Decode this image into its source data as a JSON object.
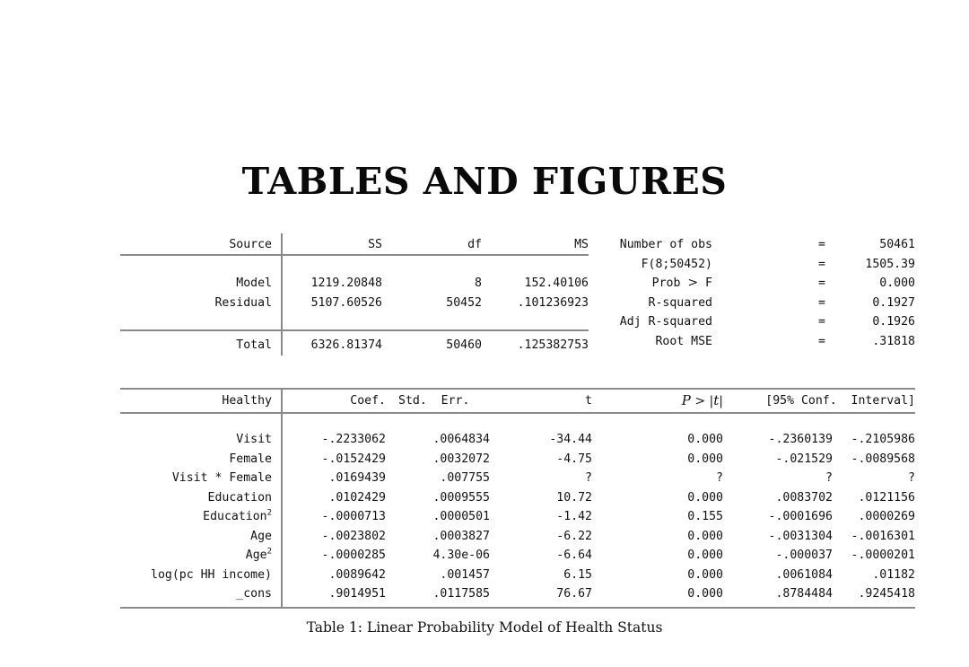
{
  "page": {
    "title": "TABLES AND FIGURES",
    "caption": "Table 1: Linear Probability Model of Health Status"
  },
  "anova_table": {
    "headers": {
      "source": "Source",
      "ss": "SS",
      "df": "df",
      "ms": "MS"
    },
    "rows": [
      {
        "source": "Model",
        "ss": "1219.20848",
        "df": "8",
        "ms": "152.40106"
      },
      {
        "source": "Residual",
        "ss": "5107.60526",
        "df": "50452",
        "ms": ".101236923"
      },
      {
        "source": "Total",
        "ss": "6326.81374",
        "df": "50460",
        "ms": ".125382753"
      }
    ],
    "stats": [
      {
        "label": "Number of obs",
        "eq": "=",
        "value": "50461"
      },
      {
        "label": "F(8;50452)",
        "eq": "=",
        "value": "1505.39"
      },
      {
        "label": "Prob > F",
        "eq": "=",
        "value": "0.000"
      },
      {
        "label": "R-squared",
        "eq": "=",
        "value": "0.1927"
      },
      {
        "label": "Adj R-squared",
        "eq": "=",
        "value": "0.1926"
      },
      {
        "label": "Root MSE",
        "eq": "=",
        "value": ".31818"
      }
    ]
  },
  "regression_table": {
    "headers": {
      "depvar": "Healthy",
      "coef": "Coef.",
      "stderr": "Std.  Err.",
      "t": "t",
      "p": "P > |t|",
      "ci": "[95% Conf.  Interval]"
    },
    "rows": [
      {
        "var": "Visit",
        "sup": "",
        "coef": "-.2233062",
        "stderr": ".0064834",
        "t": "-34.44",
        "p": "0.000",
        "ci_lo": "-.2360139",
        "ci_hi": "-.2105986"
      },
      {
        "var": "Female",
        "sup": "",
        "coef": "-.0152429",
        "stderr": ".0032072",
        "t": "-4.75",
        "p": "0.000",
        "ci_lo": "-.021529",
        "ci_hi": "-.0089568"
      },
      {
        "var": "Visit * Female",
        "sup": "",
        "coef": ".0169439",
        "stderr": ".007755",
        "t": "?",
        "p": "?",
        "ci_lo": "?",
        "ci_hi": "?"
      },
      {
        "var": "Education",
        "sup": "",
        "coef": ".0102429",
        "stderr": ".0009555",
        "t": "10.72",
        "p": "0.000",
        "ci_lo": ".0083702",
        "ci_hi": ".0121156"
      },
      {
        "var": "Education",
        "sup": "2",
        "coef": "-.0000713",
        "stderr": ".0000501",
        "t": "-1.42",
        "p": "0.155",
        "ci_lo": "-.0001696",
        "ci_hi": ".0000269"
      },
      {
        "var": "Age",
        "sup": "",
        "coef": "-.0023802",
        "stderr": ".0003827",
        "t": "-6.22",
        "p": "0.000",
        "ci_lo": "-.0031304",
        "ci_hi": "-.0016301"
      },
      {
        "var": "Age",
        "sup": "2",
        "coef": "-.0000285",
        "stderr": "4.30e-06",
        "t": "-6.64",
        "p": "0.000",
        "ci_lo": "-.000037",
        "ci_hi": "-.0000201"
      },
      {
        "var": "log(pc HH income)",
        "sup": "",
        "coef": ".0089642",
        "stderr": ".001457",
        "t": "6.15",
        "p": "0.000",
        "ci_lo": ".0061084",
        "ci_hi": ".01182"
      },
      {
        "var": "_cons",
        "sup": "",
        "coef": ".9014951",
        "stderr": ".0117585",
        "t": "76.67",
        "p": "0.000",
        "ci_lo": ".8784484",
        "ci_hi": ".9245418"
      }
    ]
  },
  "colors": {
    "rule": "#8a8a8a",
    "text": "#111111",
    "background": "#ffffff"
  }
}
